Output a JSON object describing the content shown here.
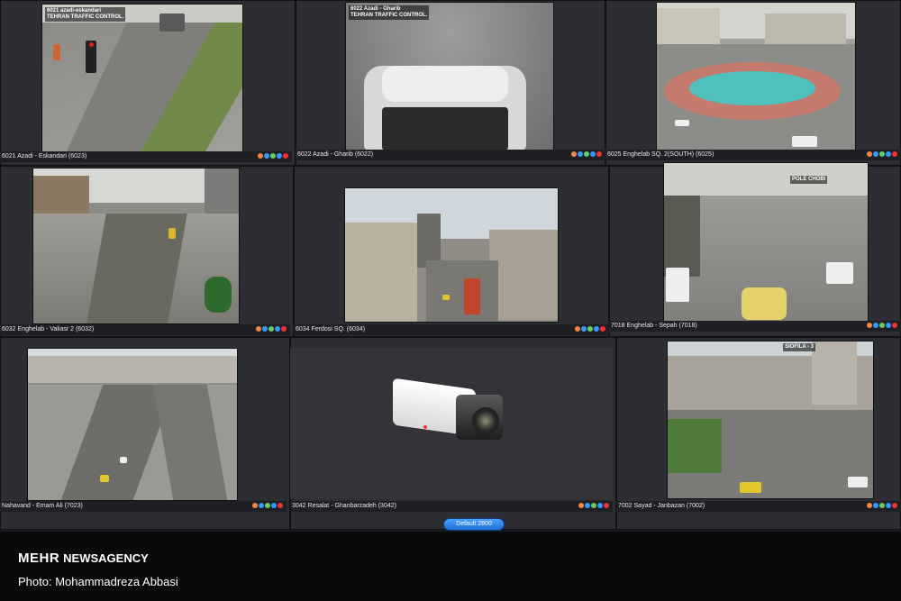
{
  "feeds": [
    {
      "caption": "6021 Azadi - Eskandari (6023)",
      "overlay": "6021 azadi-eskandari\nTEHRAN TRAFFIC CONTROL."
    },
    {
      "caption": "6022 Azadi - Gharib (6022)",
      "overlay": "6022 Azadi - Gharib\nTEHRAN TRAFFIC CONTROL."
    },
    {
      "caption": "6025 Enghelab SQ. 2(SOUTH) (6025)",
      "overlay": ""
    },
    {
      "caption": "6032 Enghelab - Valiasr 2 (6032)",
      "overlay": ""
    },
    {
      "caption": "6034 Ferdosi SQ. (6034)",
      "overlay": ""
    },
    {
      "caption": "7018 Enghelab - Sepah (7018)",
      "overlay": "POLE CHOBI"
    },
    {
      "caption": "Nahavand - Emam Ali (7023)",
      "overlay": ""
    },
    {
      "caption": "3042 Resalat - Ghanbarzadeh (3042)",
      "overlay": ""
    },
    {
      "caption": "7002 Sayad - Janbazan (7002)",
      "overlay": ""
    }
  ],
  "default_button": "Default 2800",
  "watermark": {
    "agency": "MEHR",
    "agency_suffix": "NEWSAGENCY",
    "credit": "Photo: Mohammadreza Abbasi"
  },
  "colors": {
    "wall": "#1a1b1f",
    "panel": "#2d2e33",
    "button": "#2a84e8"
  }
}
